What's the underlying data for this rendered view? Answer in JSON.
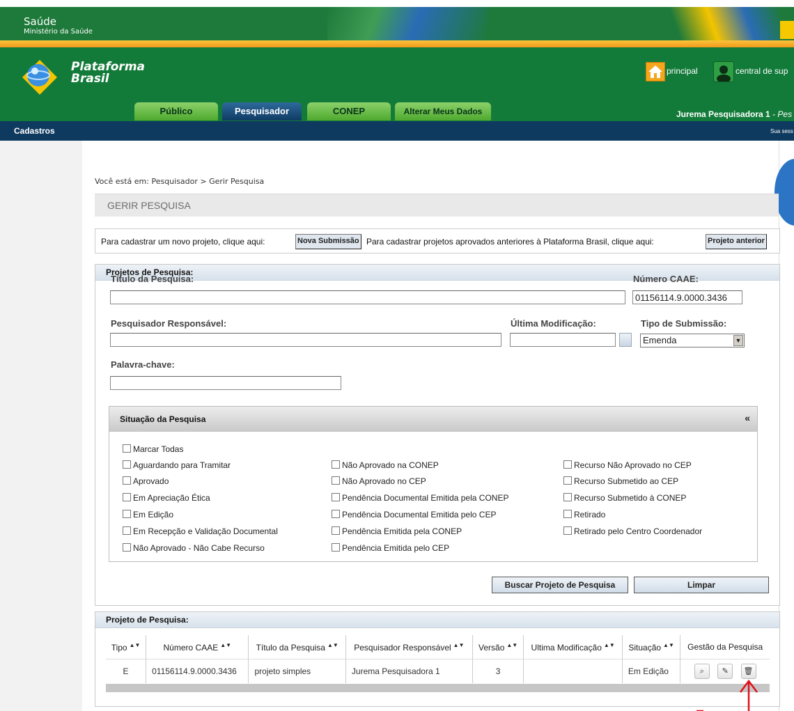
{
  "saude": {
    "title": "Saúde",
    "subtitle": "Ministério da Saúde"
  },
  "brand": {
    "line1": "Plataforma",
    "line2": "Brasil"
  },
  "header_links": {
    "home": "principal",
    "support": "central de sup"
  },
  "tabs": [
    {
      "label": "Público"
    },
    {
      "label": "Pesquisador"
    },
    {
      "label": "CONEP"
    },
    {
      "label": "Alterar Meus Dados"
    }
  ],
  "user": {
    "name": "Jurema Pesquisadora 1",
    "role": " - Pes"
  },
  "nav": {
    "cadastros": "Cadastros",
    "session": "Sua sess"
  },
  "breadcrumb": "Você está em: Pesquisador > Gerir Pesquisa",
  "page_title": "GERIR PESQUISA",
  "submission": {
    "text1": "Para cadastrar um novo projeto, clique aqui:",
    "btn1": "Nova Submissão",
    "text2": "Para cadastrar projetos aprovados anteriores à Plataforma Brasil, clique aqui:",
    "btn2": "Projeto anterior"
  },
  "search": {
    "header": "Projetos de Pesquisa:",
    "titulo_label": "Título da Pesquisa:",
    "titulo_value": "",
    "caae_label": "Número CAAE:",
    "caae_value": "01156114.9.0000.3436",
    "pesquisador_label": "Pesquisador Responsável:",
    "pesquisador_value": "",
    "modificacao_label": "Última Modificação:",
    "modificacao_value": "",
    "tipo_label": "Tipo de Submissão:",
    "tipo_value": "Emenda",
    "palavra_label": "Palavra-chave:",
    "palavra_value": ""
  },
  "situacao": {
    "title": "Situação da Pesquisa",
    "collapse": "«",
    "marcar_todas": "Marcar Todas",
    "col1": [
      "Aguardando para Tramitar",
      "Aprovado",
      "Em Apreciação Ética",
      "Em Edição",
      "Em Recepção e Validação Documental",
      "Não Aprovado - Não Cabe Recurso"
    ],
    "col2": [
      "Não Aprovado na CONEP",
      "Não Aprovado no CEP",
      "Pendência Documental Emitida pela CONEP",
      "Pendência Documental Emitida pelo CEP",
      "Pendência Emitida pela CONEP",
      "Pendência Emitida pelo CEP"
    ],
    "col3": [
      "Recurso Não Aprovado no CEP",
      "Recurso Submetido ao CEP",
      "Recurso Submetido à CONEP",
      "Retirado",
      "Retirado pelo Centro Coordenador"
    ]
  },
  "buttons": {
    "buscar": "Buscar Projeto de Pesquisa",
    "limpar": "Limpar"
  },
  "results": {
    "header": "Projeto de Pesquisa:",
    "columns": [
      "Tipo",
      "Número CAAE",
      "Título da Pesquisa",
      "Pesquisador Responsável",
      "Versão",
      "Ultima Modificação",
      "Situação",
      "Gestão da Pesquisa"
    ],
    "rows": [
      {
        "tipo": "E",
        "caae": "01156114.9.0000.3436",
        "titulo": "projeto simples",
        "pesquisador": "Jurema Pesquisadora 1",
        "versao": "3",
        "modificacao": "",
        "situacao": "Em Edição"
      }
    ]
  }
}
